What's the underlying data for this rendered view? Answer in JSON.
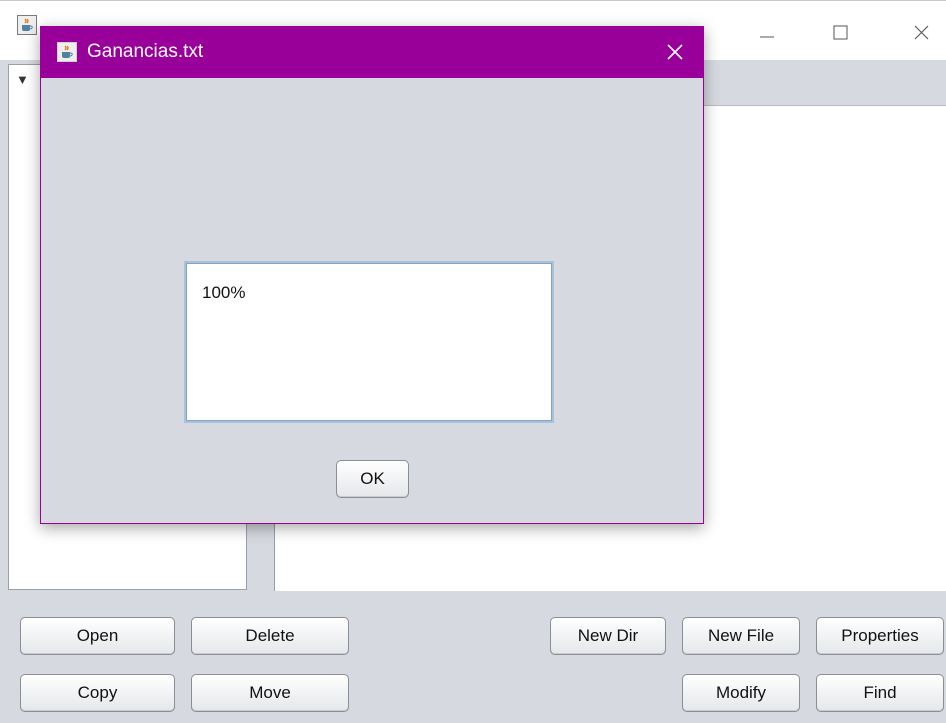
{
  "dialog": {
    "title": "Ganancias.txt",
    "content": "100%",
    "ok_label": "OK"
  },
  "toolbar": {
    "row1": [
      {
        "name": "open-button",
        "label": "Open"
      },
      {
        "name": "delete-button",
        "label": "Delete"
      },
      {
        "name": "new-dir-button",
        "label": "New Dir"
      },
      {
        "name": "new-file-button",
        "label": "New File"
      },
      {
        "name": "properties-button",
        "label": "Properties"
      }
    ],
    "row2": [
      {
        "name": "copy-button",
        "label": "Copy"
      },
      {
        "name": "move-button",
        "label": "Move"
      },
      {
        "name": "modify-button",
        "label": "Modify"
      },
      {
        "name": "find-button",
        "label": "Find"
      }
    ]
  },
  "tree": {
    "expand_glyph": "▼"
  },
  "colors": {
    "dialog_titlebar": "#990099",
    "panel_bg": "#d6d9df",
    "textarea_border": "#a9c2d9"
  },
  "icons": {
    "app": "java-coffee-icon",
    "minimize": "minimize-icon",
    "maximize": "maximize-icon",
    "close": "close-icon"
  }
}
